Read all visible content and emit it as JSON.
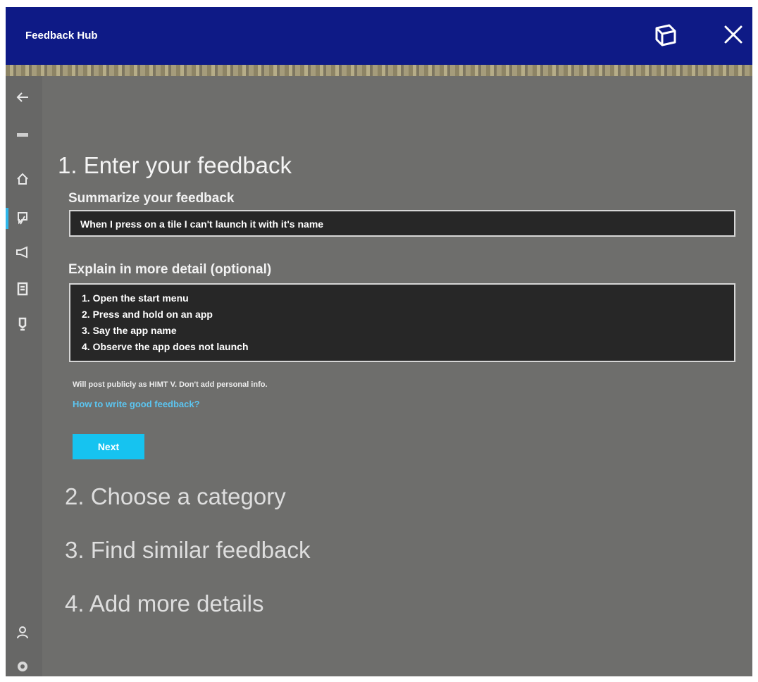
{
  "window": {
    "title": "Feedback Hub",
    "colors": {
      "titlebar": "#0e1a86",
      "background": "#6e6e6c",
      "accent": "#16c3f0"
    },
    "controls": [
      "tile-window-icon",
      "close-icon"
    ]
  },
  "sidebar": {
    "items": [
      {
        "name": "back",
        "icon": "back-arrow-icon"
      },
      {
        "name": "menu",
        "icon": "hamburger-icon"
      },
      {
        "name": "home",
        "icon": "home-icon"
      },
      {
        "name": "feedback",
        "icon": "feedback-icon",
        "active": true
      },
      {
        "name": "announcements",
        "icon": "megaphone-icon"
      },
      {
        "name": "quests",
        "icon": "quests-icon"
      },
      {
        "name": "achievements",
        "icon": "achievements-icon"
      },
      {
        "name": "profile",
        "icon": "person-icon"
      },
      {
        "name": "settings",
        "icon": "gear-icon"
      }
    ]
  },
  "form": {
    "step1_title": "1. Enter your feedback",
    "summary_label": "Summarize your feedback",
    "summary_value": "When I press on a tile I can't launch it with it's name",
    "detail_label": "Explain in more detail (optional)",
    "detail_lines": [
      "1. Open the start menu",
      "2. Press and hold on an app",
      "3. Say the app name",
      "4. Observe the app does not launch"
    ],
    "notice": "Will post publicly as HIMT V. Don't add personal info.",
    "help_link": "How to write good feedback?",
    "next_label": "Next"
  },
  "steps": [
    "2. Choose a category",
    "3. Find similar feedback",
    "4. Add more details"
  ]
}
